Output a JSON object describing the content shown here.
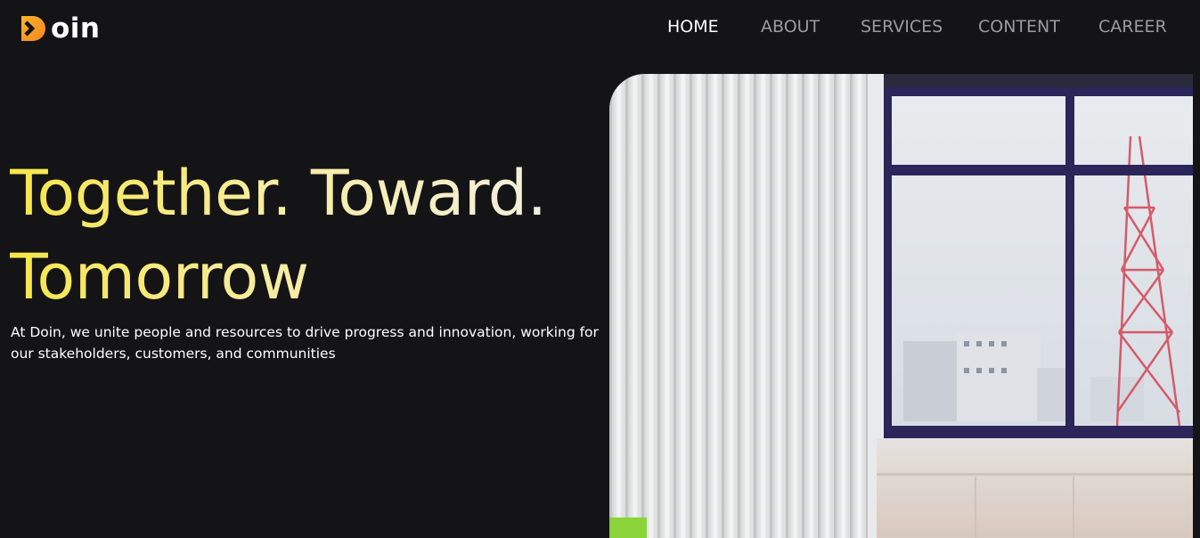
{
  "brand": {
    "name": "oin",
    "accent": "#f6a623",
    "accent_dark": "#f58b1f"
  },
  "nav": {
    "items": [
      {
        "label": "HOME",
        "active": true
      },
      {
        "label": "ABOUT",
        "active": false
      },
      {
        "label": "SERVICES",
        "active": false
      },
      {
        "label": "CONTENT",
        "active": false
      },
      {
        "label": "CAREER",
        "active": false
      }
    ]
  },
  "hero": {
    "headline_line1": "Together. Toward.",
    "headline_line2": "Tomorrow",
    "subtext": "At Doin, we unite people and resources to drive progress and innovation, working for our stakeholders, customers, and communities",
    "gradient_colors": [
      "#f6e64a",
      "#f7ec9b",
      "#f2f0e4"
    ],
    "media_icon": "office-window-photo"
  },
  "colors": {
    "background": "#141316",
    "nav_active": "#ffffff",
    "nav_inactive": "#9b9b9e"
  }
}
